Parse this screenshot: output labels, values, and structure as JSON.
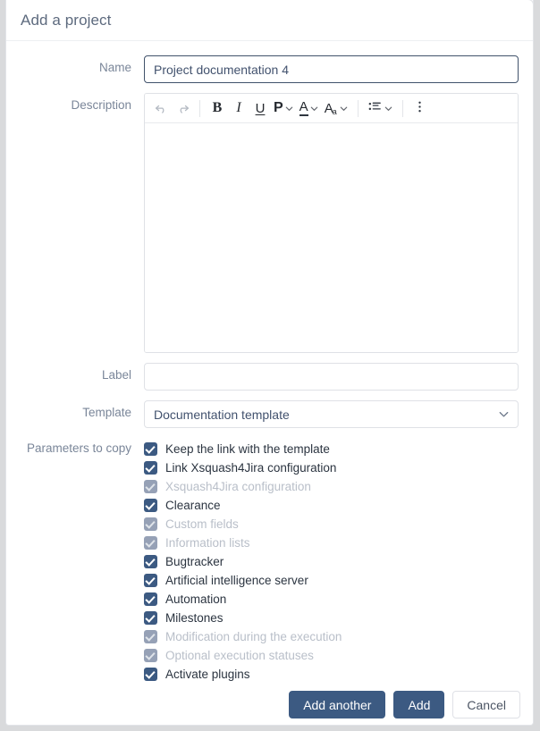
{
  "dialog": {
    "title": "Add a project"
  },
  "form": {
    "name": {
      "label": "Name",
      "value": "Project documentation 4",
      "placeholder": ""
    },
    "description": {
      "label": "Description",
      "value": "",
      "placeholder": ""
    },
    "label_field": {
      "label": "Label",
      "value": "",
      "placeholder": ""
    },
    "template": {
      "label": "Template",
      "value": "Documentation template"
    }
  },
  "editor_toolbar": {
    "undo": "↶",
    "redo": "↷",
    "bold": "B",
    "italic": "I",
    "underline": "U",
    "paragraph": "P",
    "font_color": "A",
    "font_size_main": "A",
    "font_size_sub": "a",
    "more": "⋮"
  },
  "parameters": {
    "label": "Parameters to copy",
    "items": [
      {
        "label": "Keep the link with the template",
        "checked": true,
        "disabled": false
      },
      {
        "label": "Link Xsquash4Jira configuration",
        "checked": true,
        "disabled": false
      },
      {
        "label": "Xsquash4Jira configuration",
        "checked": true,
        "disabled": true
      },
      {
        "label": "Clearance",
        "checked": true,
        "disabled": false
      },
      {
        "label": "Custom fields",
        "checked": true,
        "disabled": true
      },
      {
        "label": "Information lists",
        "checked": true,
        "disabled": true
      },
      {
        "label": "Bugtracker",
        "checked": true,
        "disabled": false
      },
      {
        "label": "Artificial intelligence server",
        "checked": true,
        "disabled": false
      },
      {
        "label": "Automation",
        "checked": true,
        "disabled": false
      },
      {
        "label": "Milestones",
        "checked": true,
        "disabled": false
      },
      {
        "label": "Modification during the execution",
        "checked": true,
        "disabled": true
      },
      {
        "label": "Optional execution statuses",
        "checked": true,
        "disabled": true
      },
      {
        "label": "Activate plugins",
        "checked": true,
        "disabled": false
      }
    ]
  },
  "footer": {
    "add_another": "Add another",
    "add": "Add",
    "cancel": "Cancel"
  },
  "colors": {
    "primary": "#3c5a82",
    "title_text": "#5d6a7e",
    "label_text": "#7a8699",
    "border": "#dfe1e6",
    "backdrop": "#d9dadc"
  }
}
